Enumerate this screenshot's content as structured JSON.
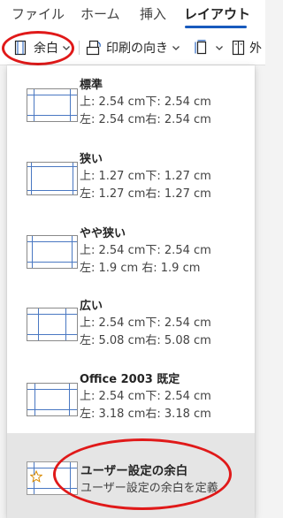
{
  "tabs": [
    {
      "label": "ファイル"
    },
    {
      "label": "ホーム"
    },
    {
      "label": "挿入"
    },
    {
      "label": "レイアウト"
    }
  ],
  "toolbar": {
    "margins_label": "余白",
    "orientation_label": "印刷の向き",
    "columns_label": "外"
  },
  "margins_menu": {
    "presets": [
      {
        "title": "標準",
        "line1": "上: 2.54 cm下: 2.54 cm",
        "line2": "左: 2.54 cm右: 2.54 cm"
      },
      {
        "title": "狭い",
        "line1": "上: 1.27 cm下: 1.27 cm",
        "line2": "左: 1.27 cm右: 1.27 cm"
      },
      {
        "title": "やや狭い",
        "line1": "上: 2.54 cm下: 2.54 cm",
        "line2": "左: 1.9 cm  右: 1.9 cm"
      },
      {
        "title": "広い",
        "line1": "上: 2.54 cm下: 2.54 cm",
        "line2": "左: 5.08 cm右: 5.08 cm"
      },
      {
        "title": "Office 2003 既定",
        "line1": "上: 2.54 cm下: 2.54 cm",
        "line2": "左: 3.18 cm右: 3.18 cm"
      }
    ],
    "custom": {
      "title": "ユーザー設定の余白",
      "subtitle": "ユーザー設定の余白を定義"
    }
  },
  "colors": {
    "accent": "#185abd",
    "annotation_red": "#e01919",
    "margin_line": "#4a78c2"
  },
  "icons": {
    "margins": "margins-icon",
    "orientation": "orientation-icon",
    "size": "page-size-icon",
    "columns": "columns-icon",
    "custom": "star-icon"
  }
}
